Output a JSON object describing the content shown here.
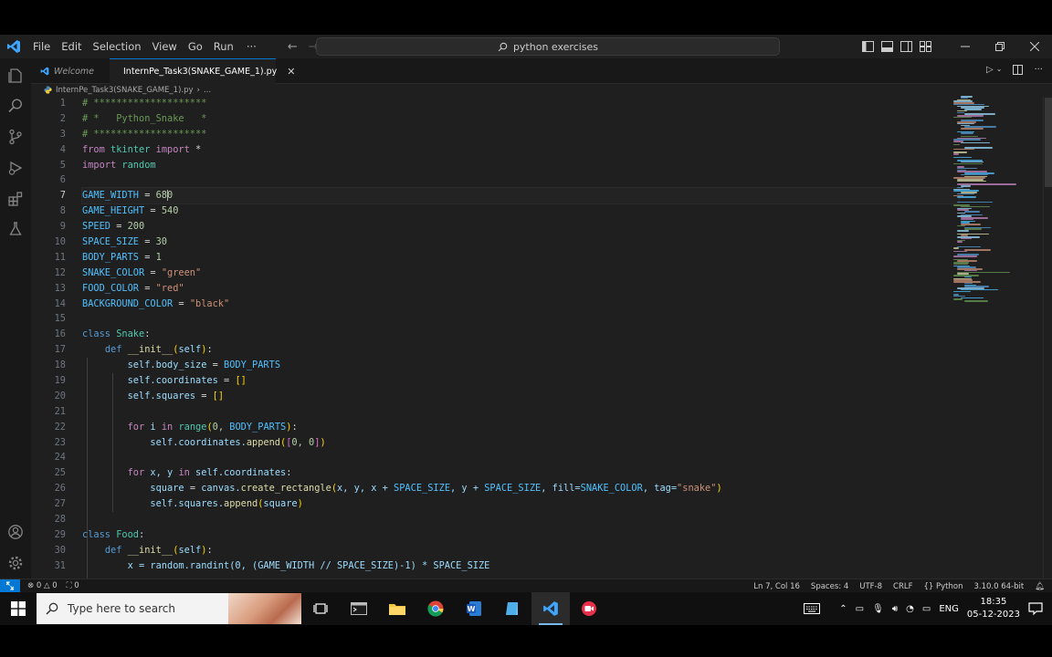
{
  "menu": {
    "file": "File",
    "edit": "Edit",
    "selection": "Selection",
    "view": "View",
    "go": "Go",
    "run": "Run",
    "more": "···"
  },
  "search": {
    "text": "python exercises"
  },
  "tabs": [
    {
      "label": "Welcome"
    },
    {
      "label": "InternPe_Task3(SNAKE_GAME_1).py"
    }
  ],
  "breadcrumb": {
    "file": "InternPe_Task3(SNAKE_GAME_1).py",
    "more": "..."
  },
  "editor": {
    "current_line": 7,
    "line_numbers": [
      "1",
      "2",
      "3",
      "4",
      "5",
      "6",
      "7",
      "8",
      "9",
      "10",
      "11",
      "12",
      "13",
      "14",
      "15",
      "16",
      "17",
      "18",
      "19",
      "20",
      "21",
      "22",
      "23",
      "24",
      "25",
      "26",
      "27",
      "28",
      "29",
      "30",
      "31"
    ],
    "code": {
      "l1": "# ********************",
      "l2": "# *   Python_Snake   *",
      "l3": "# ********************",
      "l4_kw1": "from",
      "l4_mod": "tkinter",
      "l4_kw2": "import",
      "l4_star": "*",
      "l5_kw": "import",
      "l5_mod": "random",
      "l7_var": "GAME_WIDTH",
      "l7_eq": "=",
      "l7_a": "68",
      "l7_b": "0",
      "l8_var": "GAME_HEIGHT",
      "l8_eq": "=",
      "l8_val": "540",
      "l9_var": "SPEED",
      "l9_eq": "=",
      "l9_val": "200",
      "l10_var": "SPACE_SIZE",
      "l10_eq": "=",
      "l10_val": "30",
      "l11_var": "BODY_PARTS",
      "l11_eq": "=",
      "l11_val": "1",
      "l12_var": "SNAKE_COLOR",
      "l12_eq": "=",
      "l12_val": "\"green\"",
      "l13_var": "FOOD_COLOR",
      "l13_eq": "=",
      "l13_val": "\"red\"",
      "l14_var": "BACKGROUND_COLOR",
      "l14_eq": "=",
      "l14_val": "\"black\"",
      "l16_kw": "class",
      "l16_name": "Snake",
      "l16_colon": ":",
      "l17_kw": "def",
      "l17_fn": "__init__",
      "l17_p1": "(",
      "l17_self": "self",
      "l17_p2": ")",
      "l17_colon": ":",
      "l18_self": "self",
      "l18_attr": ".body_size",
      "l18_eq": "=",
      "l18_val": "BODY_PARTS",
      "l19_self": "self",
      "l19_attr": ".coordinates",
      "l19_eq": "=",
      "l19_val": "[]",
      "l20_self": "self",
      "l20_attr": ".squares",
      "l20_eq": "=",
      "l20_val": "[]",
      "l22_kw1": "for",
      "l22_i": "i",
      "l22_kw2": "in",
      "l22_fn": "range",
      "l22_p1": "(",
      "l22_args": "0, ",
      "l22_bp": "BODY_PARTS",
      "l22_p2": ")",
      "l22_colon": ":",
      "l23_self": "self",
      "l23_attr": ".coordinates.",
      "l23_fn": "append",
      "l23_p1": "(",
      "l23_b1": "[",
      "l23_args": "0, 0",
      "l23_b2": "]",
      "l23_p2": ")",
      "l25_kw1": "for",
      "l25_xy": "x, y",
      "l25_kw2": "in",
      "l25_self": "self",
      "l25_attr": ".coordinates",
      "l25_colon": ":",
      "l26_var": "square",
      "l26_eq": "=",
      "l26_obj": "canvas.",
      "l26_fn": "create_rectangle",
      "l26_p1": "(",
      "l26_a1": "x, y, x + ",
      "l26_c1": "SPACE_SIZE",
      "l26_a2": ", y + ",
      "l26_c2": "SPACE_SIZE",
      "l26_a3": ", fill=",
      "l26_c3": "SNAKE_COLOR",
      "l26_a4": ", tag=",
      "l26_str": "\"snake\"",
      "l26_p2": ")",
      "l27_self": "self",
      "l27_attr": ".squares.",
      "l27_fn": "append",
      "l27_p1": "(",
      "l27_arg": "square",
      "l27_p2": ")",
      "l29_kw": "class",
      "l29_name": "Food",
      "l29_colon": ":",
      "l30_kw": "def",
      "l30_fn": "__init__",
      "l30_p1": "(",
      "l30_self": "self",
      "l30_p2": ")",
      "l30_colon": ":",
      "l31_partial": "x = random.randint(0, (GAME_WIDTH // SPACE_SIZE)-1) * SPACE_SIZE"
    }
  },
  "status": {
    "errors": "0",
    "warnings": "0",
    "ports": "0",
    "position": "Ln 7, Col 16",
    "spaces": "Spaces: 4",
    "encoding": "UTF-8",
    "eol": "CRLF",
    "language": "Python",
    "interpreter": "3.10.0 64-bit"
  },
  "taskbar": {
    "search_placeholder": "Type here to search",
    "lang": "ENG",
    "time": "18:35",
    "date": "05-12-2023"
  },
  "colors": {
    "accent": "#0078d4",
    "editor_bg": "#1f1f1f",
    "titlebar_bg": "#1f1f1f",
    "sidebar_bg": "#181818"
  }
}
